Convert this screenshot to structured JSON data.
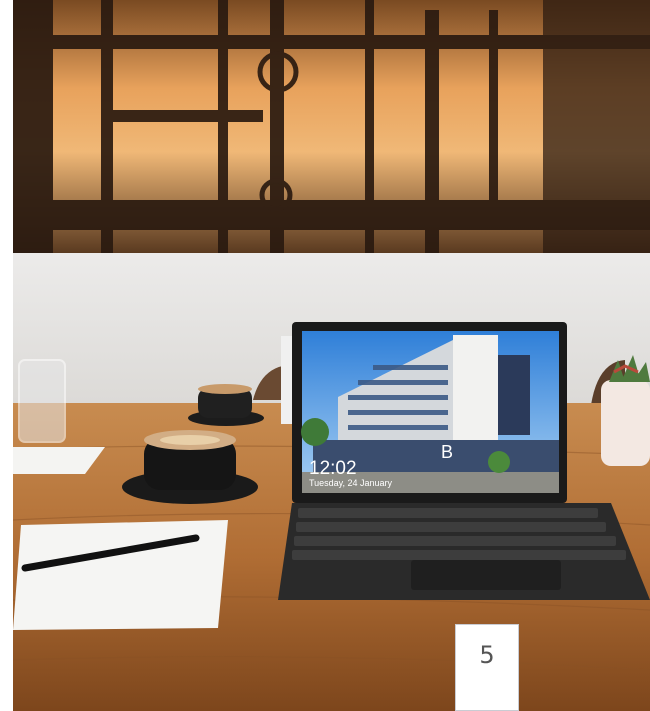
{
  "page": {
    "number": "5"
  },
  "laptop": {
    "lock_screen": {
      "time": "12:02",
      "date": "Tuesday, 24 January",
      "building_sign": "B"
    }
  },
  "colors": {
    "wall": "#e9e8e6",
    "table": "#b8753d",
    "sunset": "#e8a25c",
    "sky": "#5aa3e8"
  }
}
